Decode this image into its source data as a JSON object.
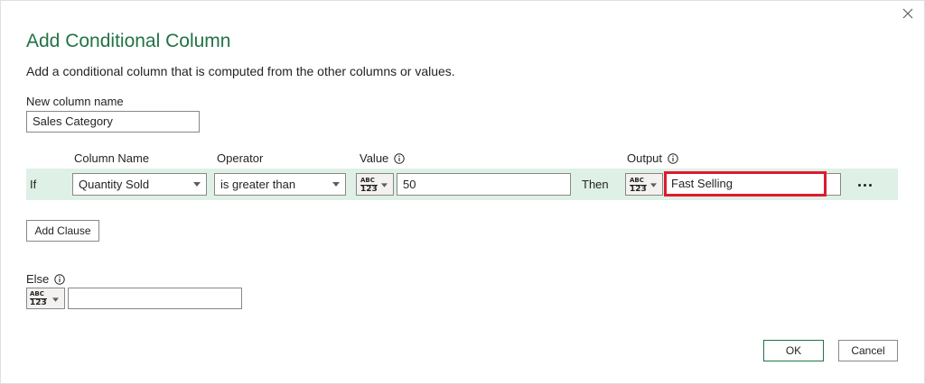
{
  "dialog": {
    "title": "Add Conditional Column",
    "subtitle": "Add a conditional column that is computed from the other columns or values.",
    "accent_color": "#217346",
    "highlight_color": "#e0192e"
  },
  "new_column": {
    "label": "New column name",
    "value": "Sales Category"
  },
  "headers": {
    "column_name": "Column Name",
    "operator": "Operator",
    "value": "Value",
    "output": "Output"
  },
  "clause": {
    "if_label": "If",
    "column_name": "Quantity Sold",
    "operator": "is greater than",
    "value_type": "ABC/123",
    "value": "50",
    "then_label": "Then",
    "output_type": "ABC/123",
    "output": "Fast Selling"
  },
  "type_icon": {
    "top": "ABC",
    "bottom": "123"
  },
  "buttons": {
    "add_clause": "Add Clause",
    "ok": "OK",
    "cancel": "Cancel"
  },
  "else": {
    "label": "Else",
    "value": ""
  },
  "icons": {
    "close": "close-icon",
    "info": "info-icon",
    "chevron": "chevron-down-icon",
    "more": "more-options-icon"
  }
}
